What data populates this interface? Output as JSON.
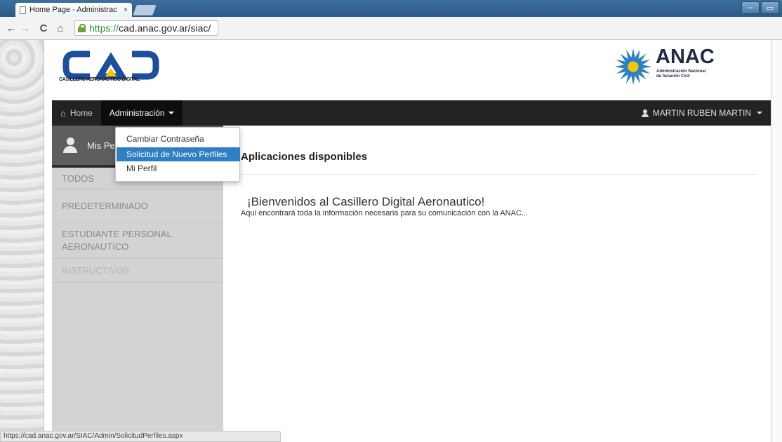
{
  "browser": {
    "tab_title": "Home Page - Administrac",
    "tab_close": "×",
    "url_scheme": "https://",
    "url_rest": "cad.anac.gov.ar/siac/",
    "nav_back": "←",
    "nav_forward": "→",
    "nav_reload": "C",
    "nav_home": "⌂",
    "win_min": "–",
    "win_max": "▭",
    "status_url": "https://cad.anac.gov.ar/SIAC/Admin/SolicitudPerfiles.aspx"
  },
  "header": {
    "cad_subtitle": "CASILLERO AERONAUTICO DIGITAL",
    "anac_name": "ANAC",
    "anac_sub_line1": "Administración Nacional",
    "anac_sub_line2": "de Aviación Civil"
  },
  "navbar": {
    "home_icon": "♠",
    "home_label": "Home",
    "admin_label": "Administración",
    "user_label": "MARTIN RUBEN MARTIN"
  },
  "dropdown": {
    "items": [
      {
        "label": "Cambiar Contraseña"
      },
      {
        "label": "Solicitud de Nuevo Perfiles"
      },
      {
        "label": "Mi Perfil"
      }
    ]
  },
  "sidebar": {
    "profile_label": "Mis Pe",
    "items": [
      {
        "label": "TODOS"
      },
      {
        "label": "PREDETERMINADO"
      },
      {
        "label": "ESTUDIANTE PERSONAL"
      },
      {
        "label": "AERONAUTICO"
      },
      {
        "label": "INSTRUCTIVOS"
      }
    ]
  },
  "main": {
    "title": "Aplicaciones disponibles",
    "welcome": "¡Bienvenidos al Casillero Digital Aeronautico!",
    "welcome_sub": "Aqui encontrará toda la información necesaria para su comunicación con la ANAC..."
  },
  "colors": {
    "navbar_bg": "#232323",
    "dropdown_active": "#2f7fc2",
    "sidebar_bg": "#d3d3d3",
    "profile_bg": "#5e5e5e",
    "anac_dark": "#1f2a44",
    "cad_blue": "#1b4e9c",
    "cad_yellow": "#f6c400"
  }
}
